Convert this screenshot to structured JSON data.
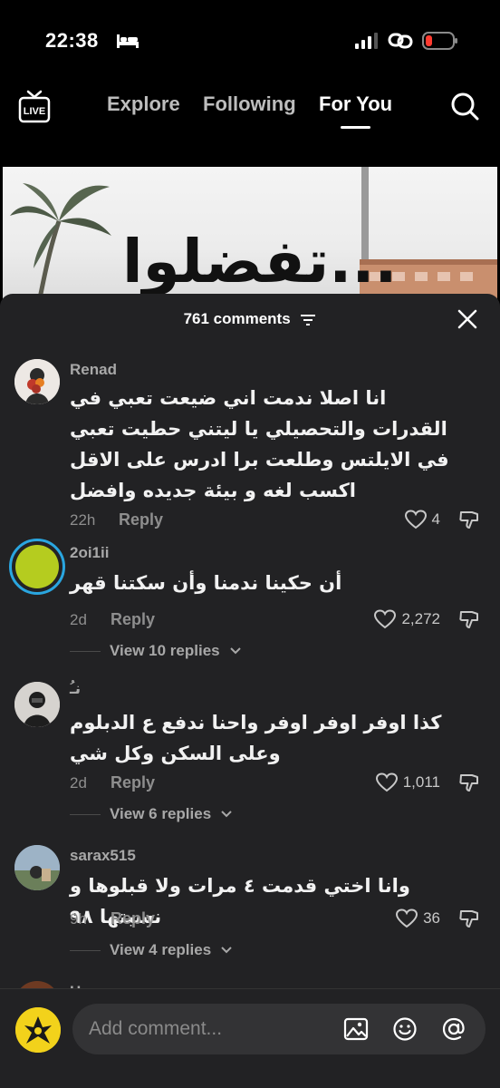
{
  "status": {
    "time": "22:38"
  },
  "nav": {
    "tabs": [
      {
        "label": "Explore"
      },
      {
        "label": "Following"
      },
      {
        "label": "For You"
      }
    ],
    "active_tab": "For You"
  },
  "video": {
    "caption": "تفضلوا..."
  },
  "sheet": {
    "count_label": "761 comments"
  },
  "comments": [
    {
      "username": "Renad",
      "text": "انا اصلا ندمت اني ضيعت تعبي في القدرات والتحصيلي يا ليتني حطيت تعبي في الايلتس وطلعت برا ادرس على الاقل اكسب لغه و بيئة جديده وافضل",
      "time": "22h",
      "reply_label": "Reply",
      "likes": "4"
    },
    {
      "username": "2oi1ii",
      "text": "أن حكينا ندمنا وأن سكتنا قهر",
      "time": "2d",
      "reply_label": "Reply",
      "likes": "2,272",
      "view_replies": "View 10 replies"
    },
    {
      "username": "نـُ",
      "text": "كذا اوفر اوفر اوفر واحنا ندفع ع الدبلوم وعلى السكن وكل شي",
      "time": "2d",
      "reply_label": "Reply",
      "likes": "1,011",
      "view_replies": "View 6 replies"
    },
    {
      "username": "sarax515",
      "text": "وانا اختي قدمت ٤ مرات ولا قبلوها و نسبتها ٩٨",
      "time": "9h",
      "reply_label": "Reply",
      "likes": "36",
      "view_replies": "View 4 replies"
    },
    {
      "username": "Нони"
    }
  ],
  "composer": {
    "placeholder": "Add comment..."
  },
  "colors": {
    "sheet_bg": "#222224",
    "accent_ring": "#2aa6e0",
    "avatar_green": "#b5cc1f",
    "battery_red": "#ff3b30"
  }
}
